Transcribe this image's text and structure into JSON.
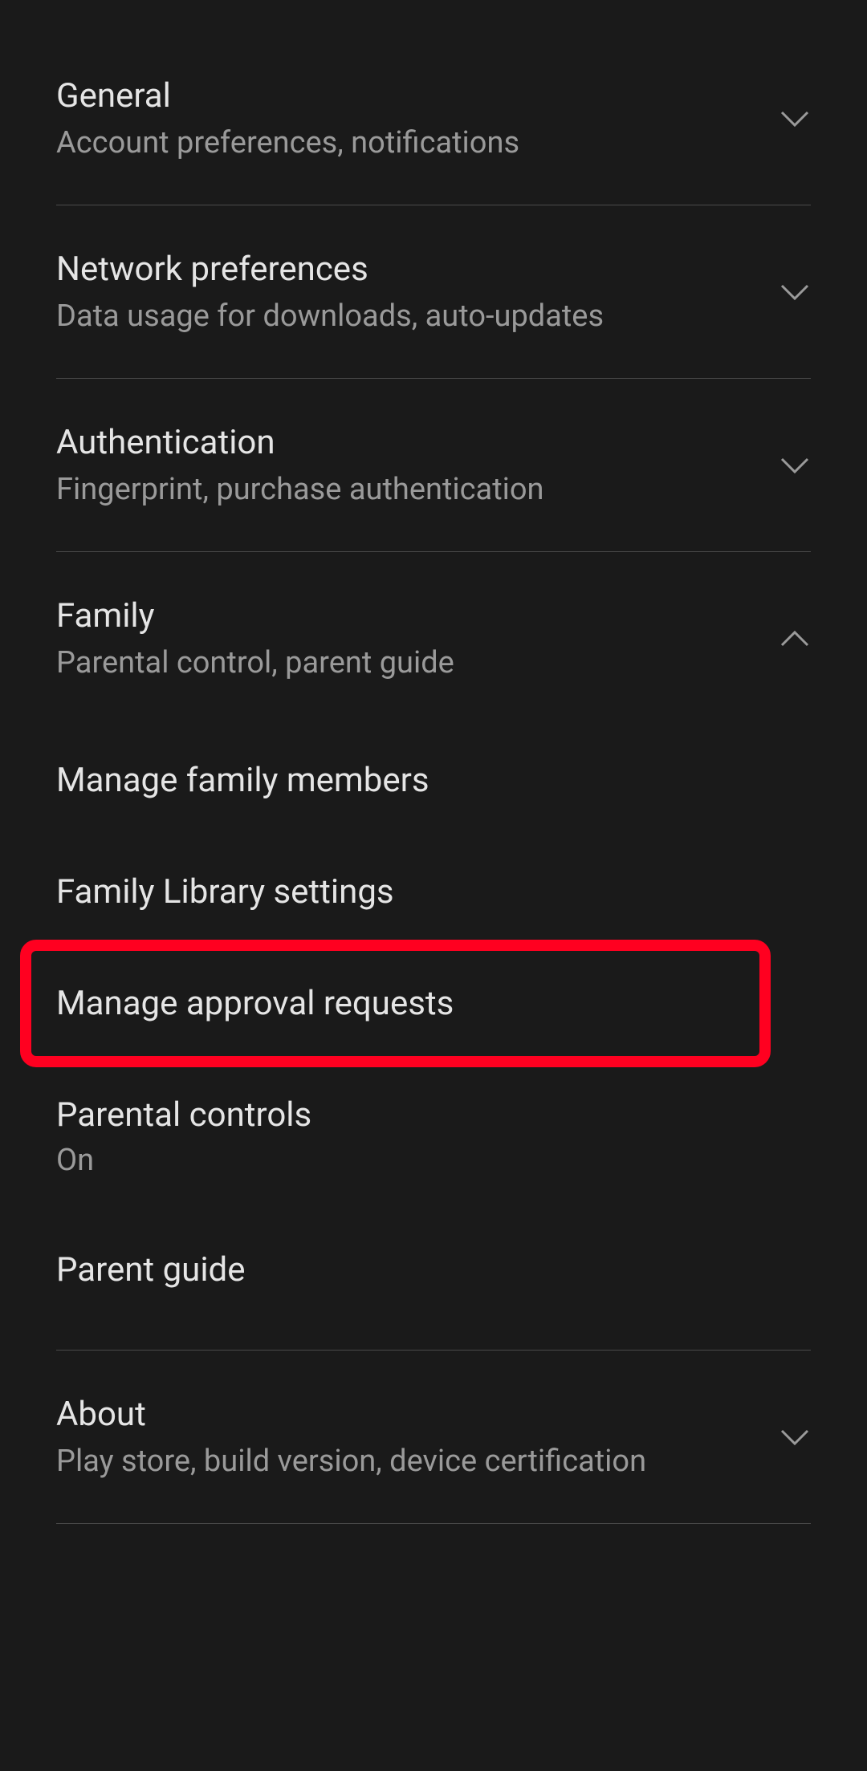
{
  "sections": {
    "general": {
      "title": "General",
      "subtitle": "Account preferences, notifications"
    },
    "network": {
      "title": "Network preferences",
      "subtitle": "Data usage for downloads, auto-updates"
    },
    "authentication": {
      "title": "Authentication",
      "subtitle": "Fingerprint, purchase authentication"
    },
    "family": {
      "title": "Family",
      "subtitle": "Parental control, parent guide",
      "items": {
        "manage_members": "Manage family members",
        "library_settings": "Family Library settings",
        "approval_requests": "Manage approval requests",
        "parental_controls": {
          "title": "Parental controls",
          "value": "On"
        },
        "parent_guide": "Parent guide"
      }
    },
    "about": {
      "title": "About",
      "subtitle": "Play store, build version, device certification"
    }
  }
}
